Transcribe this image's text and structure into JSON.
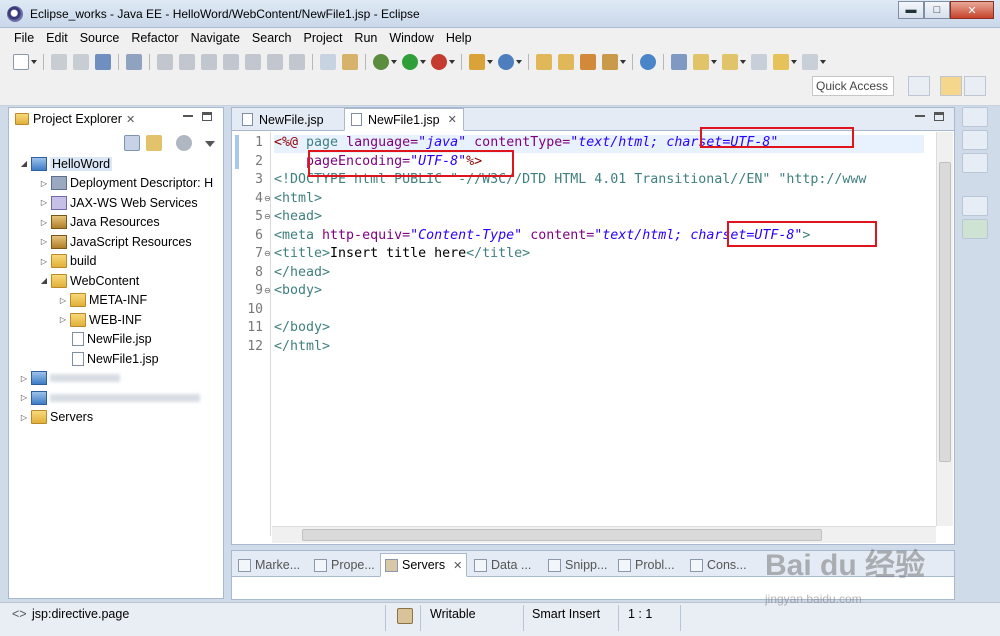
{
  "window": {
    "title": "Eclipse_works - Java EE - HelloWord/WebContent/NewFile1.jsp - Eclipse",
    "min_glyph": "▬",
    "max_glyph": "□",
    "close_glyph": "✕"
  },
  "menu": [
    "File",
    "Edit",
    "Source",
    "Refactor",
    "Navigate",
    "Search",
    "Project",
    "Run",
    "Window",
    "Help"
  ],
  "toolbar": {
    "quick_access": "Quick Access"
  },
  "project_explorer": {
    "title": "Project Explorer",
    "close_glyph": "✕",
    "tree": [
      {
        "label": "HelloWord",
        "depth": 0,
        "arrow": "◢",
        "icon": "project-icon",
        "selected": true
      },
      {
        "label": "Deployment Descriptor: H",
        "depth": 1,
        "arrow": "▷",
        "icon": "descriptor-icon"
      },
      {
        "label": "JAX-WS Web Services",
        "depth": 1,
        "arrow": "▷",
        "icon": "webservice-icon"
      },
      {
        "label": "Java Resources",
        "depth": 1,
        "arrow": "▷",
        "icon": "jar-icon"
      },
      {
        "label": "JavaScript Resources",
        "depth": 1,
        "arrow": "▷",
        "icon": "jar-icon"
      },
      {
        "label": "build",
        "depth": 1,
        "arrow": "▷",
        "icon": "folder-icon"
      },
      {
        "label": "WebContent",
        "depth": 1,
        "arrow": "◢",
        "icon": "folder-icon"
      },
      {
        "label": "META-INF",
        "depth": 2,
        "arrow": "▷",
        "icon": "folder-icon"
      },
      {
        "label": "WEB-INF",
        "depth": 2,
        "arrow": "▷",
        "icon": "folder-icon"
      },
      {
        "label": "NewFile.jsp",
        "depth": 2,
        "arrow": "",
        "icon": "jsp-file-icon"
      },
      {
        "label": "NewFile1.jsp",
        "depth": 2,
        "arrow": "",
        "icon": "jsp-file-icon"
      },
      {
        "label": "",
        "depth": 0,
        "arrow": "▷",
        "icon": "project-icon"
      },
      {
        "label": "",
        "depth": 0,
        "arrow": "▷",
        "icon": "project-icon"
      },
      {
        "label": "Servers",
        "depth": 0,
        "arrow": "▷",
        "icon": "folder-icon"
      }
    ]
  },
  "editor": {
    "tabs": [
      {
        "label": "NewFile.jsp",
        "active": false
      },
      {
        "label": "NewFile1.jsp",
        "active": true
      }
    ],
    "close_glyph": "✕",
    "line_numbers": [
      "1",
      "2",
      "3",
      "4",
      "5",
      "6",
      "7",
      "8",
      "9",
      "10",
      "11",
      "12"
    ],
    "fold_glyph": "⊖",
    "code": {
      "l1_open": "<%@ ",
      "l1_kw": "page",
      "l1_attr1": " language=",
      "l1_val1": "\"java\"",
      "l1_attr2": " contentType=",
      "l1_val2": "\"text/html; charset=UTF-8\"",
      "l2_indent": "    ",
      "l2_attr": "pageEncoding=",
      "l2_val": "\"UTF-8\"",
      "l2_close": "%>",
      "l3": "<!DOCTYPE html PUBLIC \"-//W3C//DTD HTML 4.01 Transitional//EN\" \"http://www",
      "l4": "<html>",
      "l5": "<head>",
      "l6_tag": "<meta",
      "l6_attr1": " http-equiv=",
      "l6_val1": "\"Content-Type\"",
      "l6_attr2": " content=",
      "l6_val2": "\"text/html; charset=UTF-8\"",
      "l6_end": ">",
      "l7_open": "<title>",
      "l7_text": "Insert title here",
      "l7_close": "</title>",
      "l8": "</head>",
      "l9": "<body>",
      "l10": "",
      "l11": "</body>",
      "l12": "</html>"
    }
  },
  "bottom_panel": {
    "tabs": [
      {
        "label": "Marke...",
        "active": false
      },
      {
        "label": "Prope...",
        "active": false
      },
      {
        "label": "Servers",
        "active": true
      },
      {
        "label": "Data ...",
        "active": false
      },
      {
        "label": "Snipp...",
        "active": false
      },
      {
        "label": "Probl...",
        "active": false
      },
      {
        "label": "Cons...",
        "active": false
      }
    ],
    "close_glyph": "✕"
  },
  "status_bar": {
    "path": "jsp:directive.page",
    "write_mode": "Writable",
    "insert_mode": "Smart Insert",
    "position": "1 : 1"
  },
  "watermark": "Bai du 经验",
  "watermark_url": "jingyan.baidu.com"
}
